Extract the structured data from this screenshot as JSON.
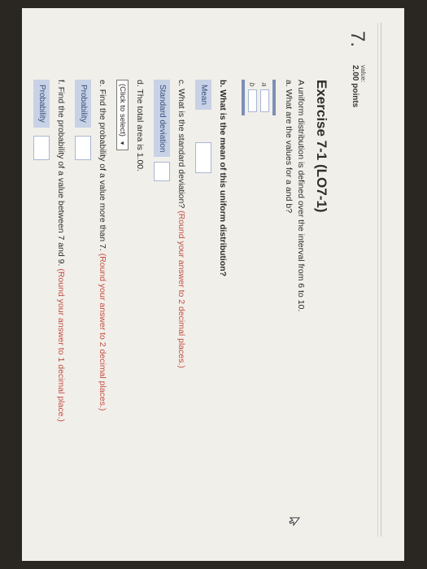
{
  "question": {
    "number": "7.",
    "value_label": "value:",
    "value_points": "2.00 points"
  },
  "exercise": {
    "title": "Exercise 7-1 (LO7-1)",
    "intro": "A uniform distribution is defined over the interval from 6 to 10."
  },
  "part_a": {
    "prefix": "a.",
    "question": "What are the values for a and b?",
    "labels": [
      "a",
      "b"
    ],
    "values": [
      "",
      ""
    ]
  },
  "part_b": {
    "prefix": "b.",
    "question": "What is the mean of this uniform distribution?",
    "field_label": "Mean",
    "value": ""
  },
  "part_c": {
    "prefix": "c.",
    "question": "What is the standard deviation?",
    "instruction": "(Round your answer to 2 decimal places.)",
    "field_label": "Standard deviation",
    "value": ""
  },
  "part_d": {
    "prefix": "d.",
    "statement": "The total area is 1.00.",
    "select_value": "(Click to select)"
  },
  "part_e": {
    "prefix": "e.",
    "question": "Find the probability of a value more than 7.",
    "instruction": "(Round your answer to 2 decimal places.)",
    "field_label": "Probability",
    "value": ""
  },
  "part_f": {
    "prefix": "f.",
    "question": "Find the probability of a value between 7 and 9.",
    "instruction": "(Round your answer to 1 decimal place.)",
    "field_label": "Probability",
    "value": ""
  },
  "colors": {
    "page_bg": "#f1efea",
    "field_label_bg": "#c7d2e6",
    "instruction_red": "#c24b3f"
  }
}
